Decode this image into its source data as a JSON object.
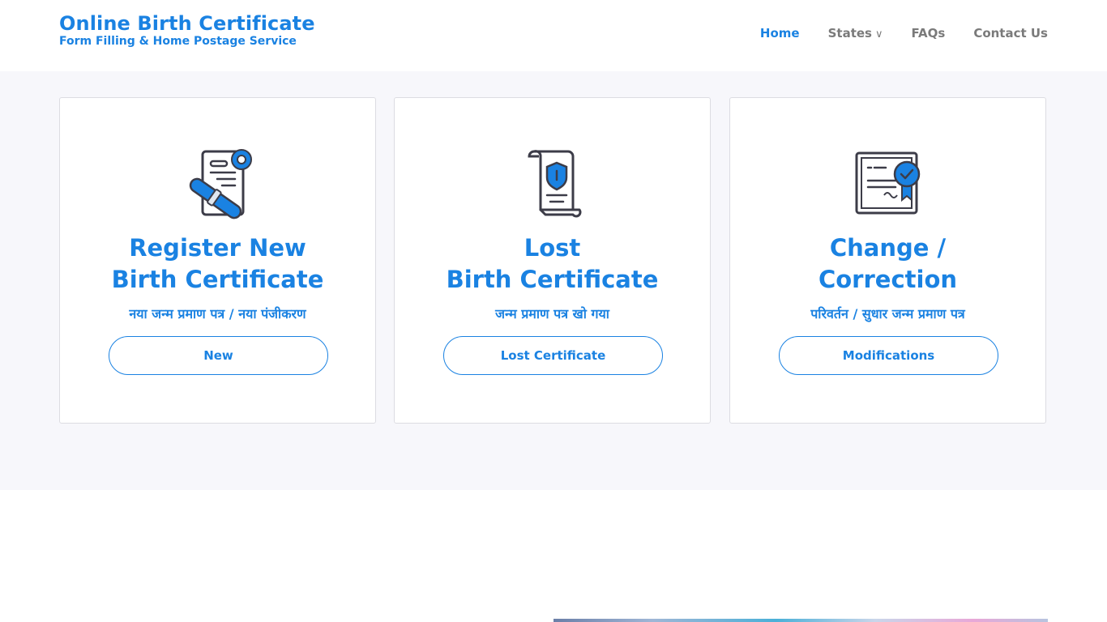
{
  "header": {
    "brand_title": "Online Birth Certificate",
    "brand_subtitle": "Form Filling & Home Postage Service",
    "nav": [
      {
        "label": "Home",
        "active": true
      },
      {
        "label": "States",
        "caret": "∨"
      },
      {
        "label": "FAQs"
      },
      {
        "label": "Contact Us"
      }
    ]
  },
  "cards": [
    {
      "icon": "certificate-scroll-gear-icon",
      "title_line1": "Register New",
      "title_line2": "Birth Certificate",
      "subtitle": "नया जन्म प्रमाण पत्र / नया पंजीकरण",
      "button": "New"
    },
    {
      "icon": "scroll-shield-icon",
      "title_line1": "Lost",
      "title_line2": "Birth Certificate",
      "subtitle": "जन्म प्रमाण पत्र खो गया",
      "button": "Lost Certificate"
    },
    {
      "icon": "certificate-badge-icon",
      "title_line1": "Change /",
      "title_line2": "Correction",
      "subtitle": "परिवर्तन / सुधार जन्म प्रमाण पत्र",
      "button": "Modifications"
    }
  ],
  "colors": {
    "accent": "#1a82e2",
    "nav_text": "#7a7a7a",
    "band_bg": "#f7f7fb",
    "icon_dark": "#3c3c48"
  }
}
